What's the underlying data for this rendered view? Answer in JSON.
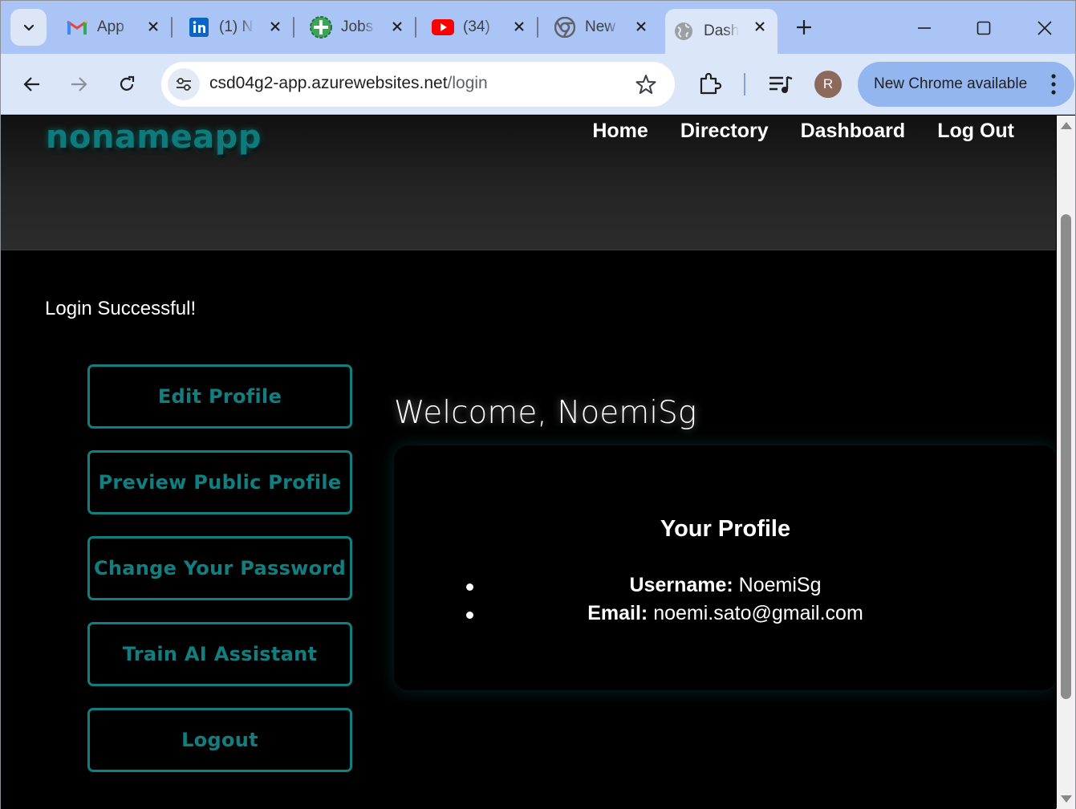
{
  "browser": {
    "tabs": [
      {
        "title": "App",
        "icon": "gmail-icon"
      },
      {
        "title": "(1) N",
        "icon": "linkedin-icon"
      },
      {
        "title": "Jobs",
        "icon": "jobs-icon"
      },
      {
        "title": "(34)",
        "icon": "youtube-icon"
      },
      {
        "title": "New",
        "icon": "chrome-icon"
      },
      {
        "title": "Dash",
        "icon": "globe-icon"
      }
    ],
    "active_tab_index": 5,
    "url_domain": "csd04g2-app.azurewebsites.net",
    "url_path": "/login",
    "profile_initial": "R",
    "update_label": "New Chrome available"
  },
  "site": {
    "logo": "nonameapp",
    "nav": {
      "home": "Home",
      "directory": "Directory",
      "dashboard": "Dashboard",
      "logout": "Log Out"
    }
  },
  "main": {
    "login_message": "Login Successful!",
    "actions": {
      "edit_profile": "Edit Profile",
      "preview_profile": "Preview Public Profile",
      "change_password": "Change Your Password",
      "train_ai": "Train AI Assistant",
      "logout": "Logout"
    },
    "welcome": "Welcome, NoemiSg",
    "profile": {
      "title": "Your Profile",
      "username_label": "Username:",
      "username_value": "NoemiSg",
      "email_label": "Email:",
      "email_value": "noemi.sato@gmail.com"
    }
  },
  "colors": {
    "accent": "#117f80",
    "browser_chrome": "#dbe6f8",
    "tabstrip": "#a9c4f5"
  }
}
